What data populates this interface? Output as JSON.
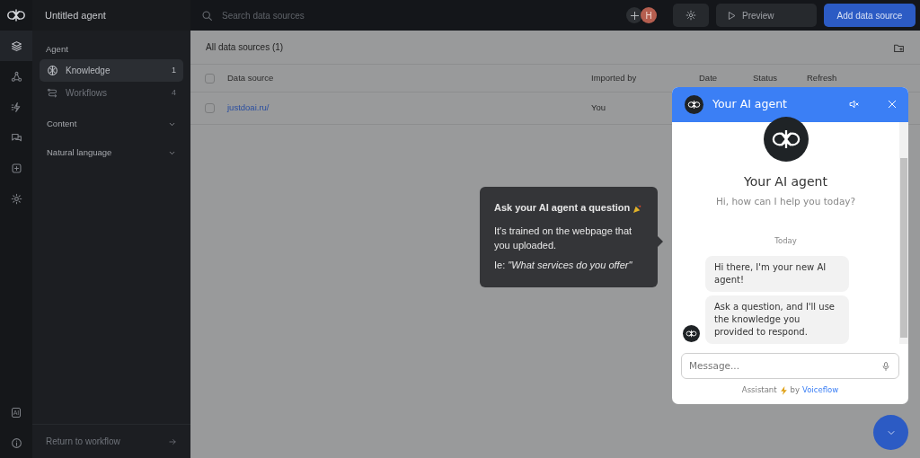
{
  "rail": {
    "items": [
      {
        "kind": "layers",
        "selected": true
      },
      {
        "kind": "nodes",
        "selected": false
      },
      {
        "kind": "bolt",
        "selected": false
      },
      {
        "kind": "chat",
        "selected": false
      },
      {
        "kind": "plus",
        "selected": false
      },
      {
        "kind": "gear",
        "selected": false
      }
    ],
    "bottom": [
      {
        "kind": "ai",
        "label": "AI",
        "selected": false
      },
      {
        "kind": "info",
        "selected": false
      }
    ]
  },
  "sidebar": {
    "title": "Untitled agent",
    "section": "Agent",
    "items": [
      {
        "kind": "brain",
        "label": "Knowledge",
        "count": "1",
        "selected": true
      },
      {
        "kind": "flow",
        "label": "Workflows",
        "count": "4",
        "selected": false
      }
    ],
    "groups": [
      {
        "label": "Content",
        "expanded": false
      },
      {
        "label": "Natural language",
        "expanded": false
      }
    ],
    "footer": "Return to workflow"
  },
  "topbar": {
    "search_placeholder": "Search data sources",
    "avatar": "H",
    "preview": "Preview",
    "add": "Add data source"
  },
  "table": {
    "title": "All data sources (1)",
    "all_selected": false,
    "columns": [
      "Data source",
      "Imported by",
      "Date",
      "Status",
      "Refresh"
    ],
    "rows": [
      {
        "selected": false,
        "cells": [
          "justdoai.ru/",
          "You"
        ]
      }
    ]
  },
  "tooltip": {
    "title": "Ask your AI agent a question",
    "body": "It's trained on the webpage that you uploaded.",
    "example": "Ie: *\"What services do you offer\"*"
  },
  "chat": {
    "title": "Your AI agent",
    "name": "Your AI agent",
    "greeting": "Hi, how can I help you today?",
    "date": "Today",
    "messages": [
      "Hi there, I'm your new AI agent!",
      "Ask a question, and I'll use the knowledge you provided to respond."
    ],
    "placeholder": "Message...",
    "footer": "Assistant",
    "by": "by",
    "brand": "Voiceflow"
  }
}
